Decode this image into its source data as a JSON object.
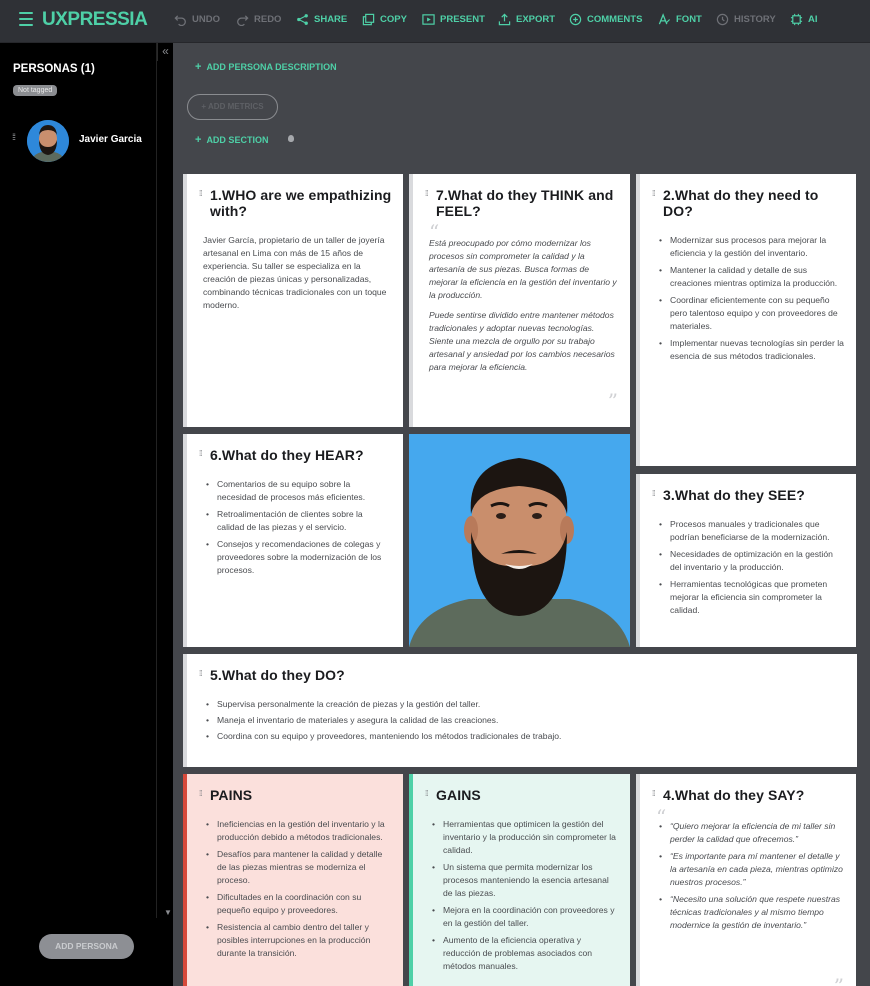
{
  "app": {
    "logo": "UXPRESSIA"
  },
  "toolbar": {
    "undo": "UNDO",
    "redo": "REDO",
    "share": "SHARE",
    "copy": "COPY",
    "present": "PRESENT",
    "export": "EXPORT",
    "comments": "COMMENTS",
    "font": "FONT",
    "history": "HISTORY",
    "ai": "AI"
  },
  "sidebar": {
    "title": "PERSONAS (1)",
    "tag": "Not tagged",
    "persona_name": "Javier Garcia",
    "add_button": "ADD PERSONA"
  },
  "main": {
    "add_description": "ADD PERSONA DESCRIPTION",
    "add_metrics": "+ ADD METRICS",
    "add_section": "ADD SECTION"
  },
  "cards": {
    "who": {
      "title": "1.WHO are we empathizing with?",
      "text": "Javier García, propietario de un taller de joyería artesanal en Lima con más de 15 años de experiencia. Su taller se especializa en la creación de piezas únicas y personalizadas, combinando técnicas tradicionales con un toque moderno."
    },
    "think": {
      "title": "7.What do they THINK and FEEL?",
      "p1": "Está preocupado por cómo modernizar los procesos sin comprometer la calidad y la artesanía de sus piezas. Busca formas de mejorar la eficiencia en la gestión del inventario y la producción.",
      "p2": "Puede sentirse dividido entre mantener métodos tradicionales y adoptar nuevas tecnologías. Siente una mezcla de orgullo por su trabajo artesanal y ansiedad por los cambios necesarios para mejorar la eficiencia."
    },
    "need": {
      "title": "2.What do they need to DO?",
      "items": [
        "Modernizar sus procesos para mejorar la eficiencia y la gestión del inventario.",
        "Mantener la calidad y detalle de sus creaciones mientras optimiza la producción.",
        "Coordinar eficientemente con su pequeño pero talentoso equipo y con proveedores de materiales.",
        "Implementar nuevas tecnologías sin perder la esencia de sus métodos tradicionales."
      ]
    },
    "hear": {
      "title": "6.What do they HEAR?",
      "items": [
        "Comentarios de su equipo sobre la necesidad de procesos más eficientes.",
        "Retroalimentación de clientes sobre la calidad de las piezas y el servicio.",
        "Consejos y recomendaciones de colegas y proveedores sobre la modernización de los procesos."
      ]
    },
    "see": {
      "title": "3.What do they SEE?",
      "items": [
        "Procesos manuales y tradicionales que podrían beneficiarse de la modernización.",
        "Necesidades de optimización en la gestión del inventario y la producción.",
        "Herramientas tecnológicas que prometen mejorar la eficiencia sin comprometer la calidad."
      ]
    },
    "do": {
      "title": "5.What do they DO?",
      "items": [
        "Supervisa personalmente la creación de piezas y la gestión del taller.",
        "Maneja el inventario de materiales y asegura la calidad de las creaciones.",
        "Coordina con su equipo y proveedores, manteniendo los métodos tradicionales de trabajo."
      ]
    },
    "pains": {
      "title": "PAINS",
      "items": [
        "Ineficiencias en la gestión del inventario y la producción debido a métodos tradicionales.",
        "Desafíos para mantener la calidad y detalle de las piezas mientras se moderniza el proceso.",
        "Dificultades en la coordinación con su pequeño equipo y proveedores.",
        "Resistencia al cambio dentro del taller y posibles interrupciones en la producción durante la transición."
      ]
    },
    "gains": {
      "title": "GAINS",
      "items": [
        "Herramientas que optimicen la gestión del inventario y la producción sin comprometer la calidad.",
        "Un sistema que permita modernizar los procesos manteniendo la esencia artesanal de las piezas.",
        "Mejora en la coordinación con proveedores y en la gestión del taller.",
        "Aumento de la eficiencia operativa y reducción de problemas asociados con métodos manuales."
      ]
    },
    "say": {
      "title": "4.What do they SAY?",
      "items": [
        "“Quiero mejorar la eficiencia de mi taller sin perder la calidad que ofrecemos.”",
        "“Es importante para mí mantener el detalle y la artesanía en cada pieza, mientras optimizo nuestros procesos.”",
        "“Necesito una solución que respete nuestras técnicas tradicionales y al mismo tiempo modernice la gestión de inventario.”"
      ]
    }
  },
  "colors": {
    "accent": "#4ed0a7",
    "pains": "#d64a3b",
    "gains": "#4ed0a7"
  }
}
